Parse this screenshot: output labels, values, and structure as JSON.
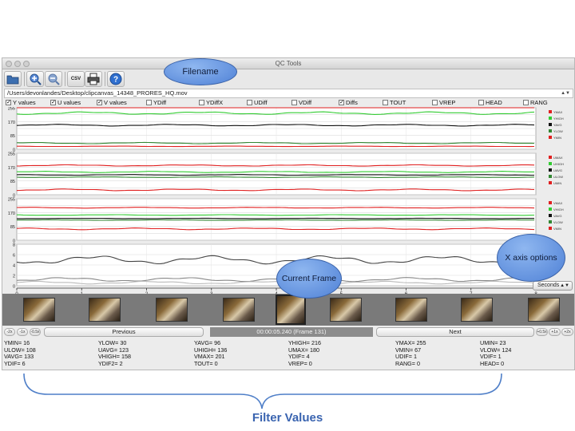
{
  "window": {
    "title": "QC Tools"
  },
  "toolbar": {
    "buttons": [
      {
        "name": "open-file-icon"
      },
      {
        "name": "zoom-in-icon"
      },
      {
        "name": "zoom-out-icon"
      },
      {
        "name": "csv-export-button",
        "label": "CSV"
      },
      {
        "name": "print-icon"
      },
      {
        "name": "help-icon",
        "label": "?"
      }
    ]
  },
  "file": {
    "path": "/Users/devonlandes/Desktop/clipcanvas_14348_PRORES_HQ.mov"
  },
  "filters": [
    {
      "label": "Y values",
      "checked": true
    },
    {
      "label": "U values",
      "checked": true
    },
    {
      "label": "V values",
      "checked": true
    },
    {
      "label": "YDiff",
      "checked": false
    },
    {
      "label": "YDiffX",
      "checked": false
    },
    {
      "label": "UDiff",
      "checked": false
    },
    {
      "label": "VDiff",
      "checked": false
    },
    {
      "label": "Diffs",
      "checked": true
    },
    {
      "label": "TOUT",
      "checked": false
    },
    {
      "label": "VREP",
      "checked": false
    },
    {
      "label": "HEAD",
      "checked": false
    },
    {
      "label": "RANG",
      "checked": false
    }
  ],
  "plots": {
    "y": {
      "ticks": [
        "255",
        "213",
        "170",
        "128",
        "85",
        "43",
        "0"
      ],
      "legend": [
        "YMAX",
        "YHIGH",
        "YAVG",
        "YLOW",
        "YMIN"
      ]
    },
    "u": {
      "ticks": [
        "255",
        "213",
        "170",
        "128",
        "85",
        "43",
        "0"
      ],
      "legend": [
        "UMAX",
        "UHIGH",
        "UAVG",
        "ULOW",
        "UMIN"
      ]
    },
    "v": {
      "ticks": [
        "255",
        "213",
        "170",
        "128",
        "85",
        "43",
        "0"
      ],
      "legend": [
        "VMAX",
        "VHIGH",
        "VAVG",
        "VLOW",
        "VMIN"
      ]
    },
    "diff": {
      "ticks": [
        "8",
        "6",
        "4",
        "2",
        "0"
      ],
      "legend": [
        "YDIF",
        "UDIF",
        "VDIF"
      ]
    },
    "x_ticks": [
      "0",
      "1",
      "2",
      "3",
      "4",
      "5",
      "6",
      "7",
      "8"
    ],
    "colors": {
      "max": "#e02020",
      "high": "#33cc33",
      "avg": "#111111",
      "low": "#338833",
      "min": "#e02020",
      "diff_y": "#444444",
      "diff_u": "#888888",
      "diff_v": "#bbbbbb"
    }
  },
  "x_axis": {
    "unit": "Seconds"
  },
  "nav": {
    "speed_left": [
      "-2x",
      "-1x",
      "-0.5x"
    ],
    "speed_right": [
      "+0.5x",
      "+1x",
      "+2x"
    ],
    "previous_label": "Previous",
    "next_label": "Next",
    "time_label": "00:00:05.240 (Frame 131)"
  },
  "values": [
    [
      "YMIN= 16",
      "ULOW= 108",
      "VAVG= 133",
      "YDIF= 6"
    ],
    [
      "YLOW= 30",
      "UAVG= 123",
      "VHIGH= 158",
      "YDIF2= 2"
    ],
    [
      "YAVG= 96",
      "UHIGH= 136",
      "VMAX= 201",
      "TOUT= 0"
    ],
    [
      "YHIGH= 216",
      "UMAX= 180",
      "YDIF= 4",
      "VREP= 0"
    ],
    [
      "YMAX= 255",
      "VMIN= 67",
      "UDIF= 1",
      "RANG= 0"
    ],
    [
      "UMIN= 23",
      "VLOW= 124",
      "VDIF= 1",
      "HEAD= 0"
    ]
  ],
  "annotations": {
    "filename": "Filename",
    "current_frame": "Current Frame",
    "x_axis_options": "X axis options",
    "filter_values": "Filter Values"
  }
}
